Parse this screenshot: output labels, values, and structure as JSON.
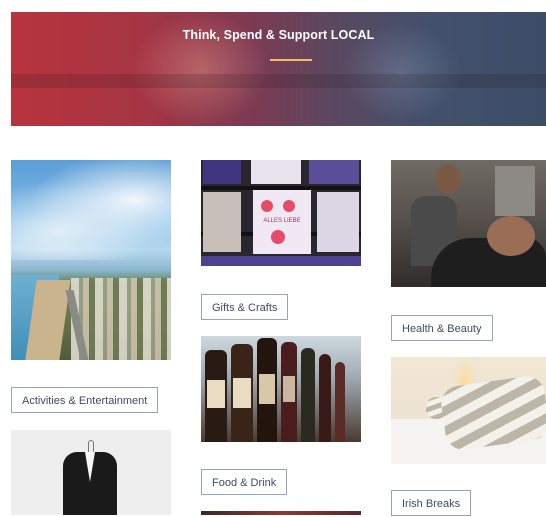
{
  "hero": {
    "title": "Think, Spend & Support LOCAL",
    "accent_color": "#f0c063"
  },
  "categories": [
    {
      "label": "Gifts & Crafts"
    },
    {
      "label": "Health & Beauty"
    },
    {
      "label": "Activities & Entertainment"
    },
    {
      "label": "Food & Drink"
    },
    {
      "label": "Irish Breaks"
    }
  ],
  "cards_text": "ALLES LIEBE"
}
